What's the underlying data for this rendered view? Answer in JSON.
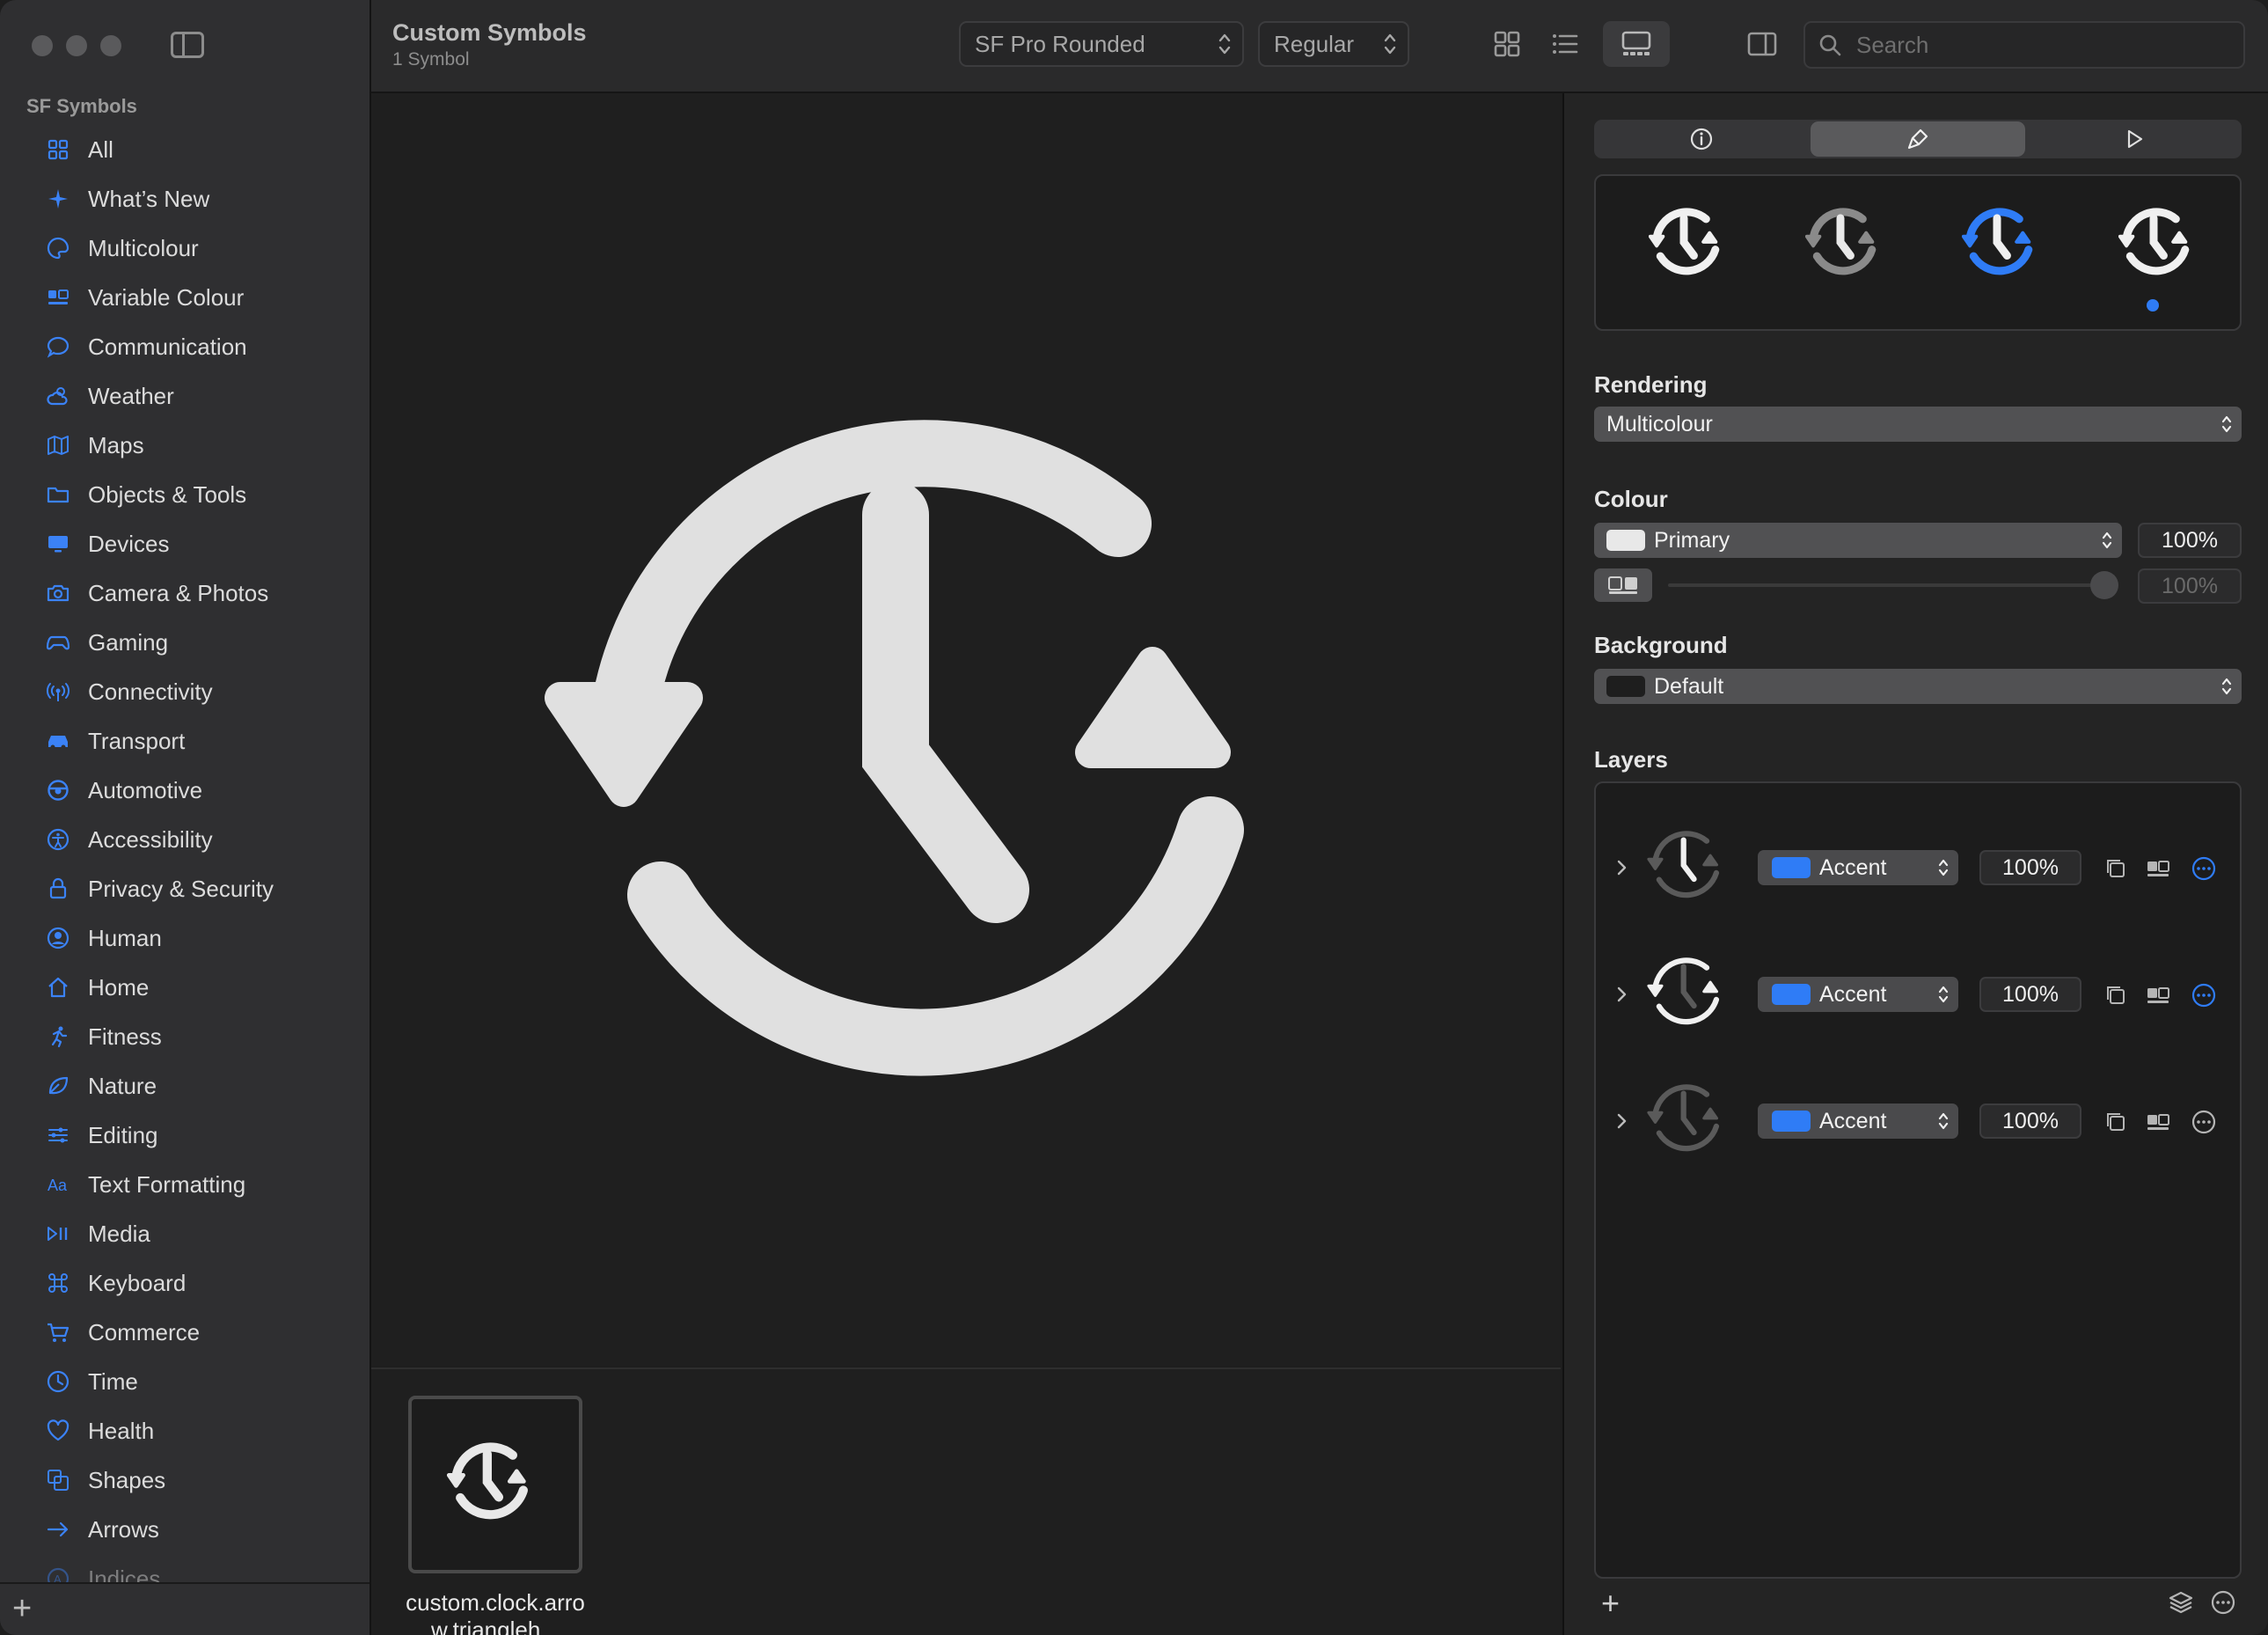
{
  "sidebar": {
    "section_title": "SF Symbols",
    "items": [
      {
        "label": "All",
        "icon": "grid-icon"
      },
      {
        "label": "What’s New",
        "icon": "sparkle-icon"
      },
      {
        "label": "Multicolour",
        "icon": "palette-icon"
      },
      {
        "label": "Variable Colour",
        "icon": "variable-colour-icon"
      },
      {
        "label": "Communication",
        "icon": "speech-bubble-icon"
      },
      {
        "label": "Weather",
        "icon": "cloud-sun-icon"
      },
      {
        "label": "Maps",
        "icon": "map-icon"
      },
      {
        "label": "Objects & Tools",
        "icon": "folder-icon"
      },
      {
        "label": "Devices",
        "icon": "display-icon"
      },
      {
        "label": "Camera & Photos",
        "icon": "camera-icon"
      },
      {
        "label": "Gaming",
        "icon": "gamecontroller-icon"
      },
      {
        "label": "Connectivity",
        "icon": "antenna-icon"
      },
      {
        "label": "Transport",
        "icon": "car-icon"
      },
      {
        "label": "Automotive",
        "icon": "steering-wheel-icon"
      },
      {
        "label": "Accessibility",
        "icon": "accessibility-icon"
      },
      {
        "label": "Privacy & Security",
        "icon": "lock-icon"
      },
      {
        "label": "Human",
        "icon": "person-icon"
      },
      {
        "label": "Home",
        "icon": "house-icon"
      },
      {
        "label": "Fitness",
        "icon": "running-figure-icon"
      },
      {
        "label": "Nature",
        "icon": "leaf-icon"
      },
      {
        "label": "Editing",
        "icon": "sliders-icon"
      },
      {
        "label": "Text Formatting",
        "icon": "textformat-icon"
      },
      {
        "label": "Media",
        "icon": "play-pause-icon"
      },
      {
        "label": "Keyboard",
        "icon": "command-icon"
      },
      {
        "label": "Commerce",
        "icon": "cart-icon"
      },
      {
        "label": "Time",
        "icon": "clock-icon"
      },
      {
        "label": "Health",
        "icon": "heart-icon"
      },
      {
        "label": "Shapes",
        "icon": "shapes-icon"
      },
      {
        "label": "Arrows",
        "icon": "arrow-right-icon"
      },
      {
        "label": "Indices",
        "icon": "indices-icon"
      }
    ],
    "add_label": "+"
  },
  "toolbar": {
    "title": "Custom Symbols",
    "subtitle": "1 Symbol",
    "font_popup": "SF Pro Rounded",
    "weight_popup": "Regular",
    "search_placeholder": "Search"
  },
  "gallery": {
    "symbol_name": "custom.clock.arrow.triangleh..."
  },
  "inspector": {
    "rendering_label": "Rendering",
    "rendering_value": "Multicolour",
    "colour_label": "Colour",
    "colour_value": "Primary",
    "colour_percent": "100%",
    "colour_slider_percent": "100%",
    "background_label": "Background",
    "background_value": "Default",
    "layers_label": "Layers",
    "layers": [
      {
        "colour": "Accent",
        "percent": "100%"
      },
      {
        "colour": "Accent",
        "percent": "100%"
      },
      {
        "colour": "Accent",
        "percent": "100%"
      }
    ],
    "add_label": "+"
  },
  "colors": {
    "accent": "#2f7cf6",
    "primary_swatch": "#e8e8e8",
    "background_swatch": "#1e1e1e",
    "symbol_fill": "#e0e0e0"
  }
}
